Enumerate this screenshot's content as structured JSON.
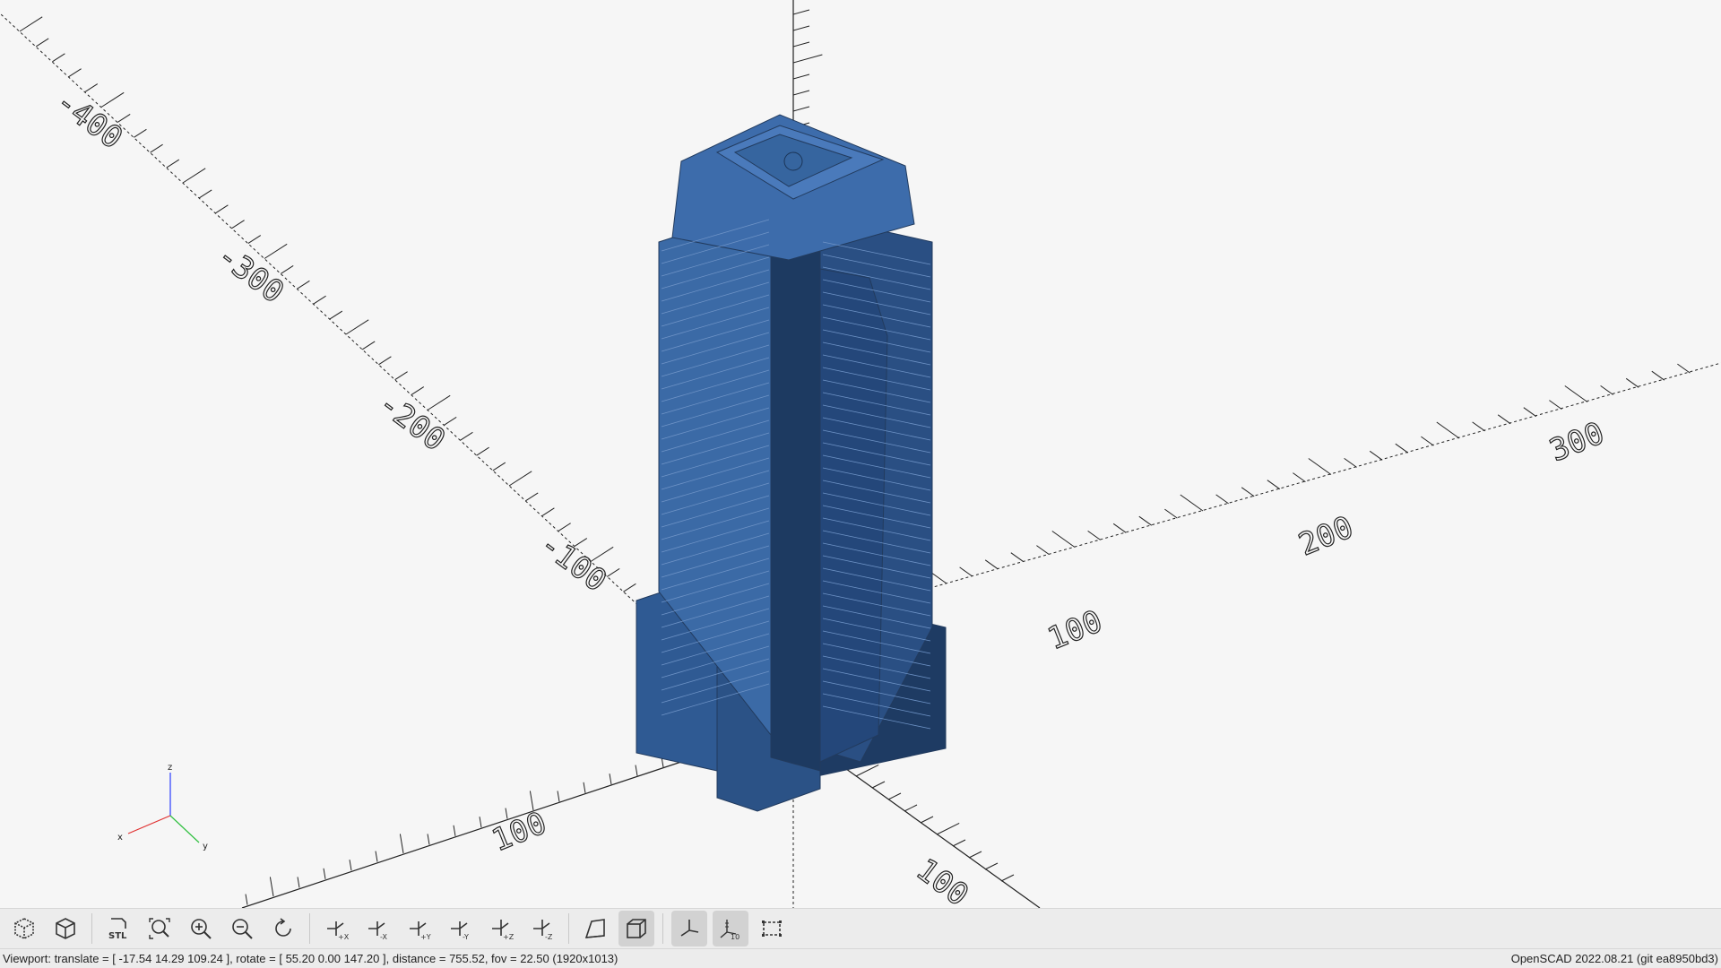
{
  "viewport": {
    "axis_labels": {
      "x_neg": [
        "-400",
        "-300",
        "-200",
        "-100"
      ],
      "y_pos": [
        "100",
        "200",
        "300"
      ],
      "near": [
        "100",
        "100"
      ]
    },
    "model_color": "#3b6aa6",
    "axis_indicator": {
      "x": "x",
      "y": "y",
      "z": "z"
    }
  },
  "toolbar": {
    "buttons": [
      {
        "icon": "render-preview-icon",
        "label": "Preview"
      },
      {
        "icon": "render-icon",
        "label": "Render"
      },
      {
        "icon": "export-stl-icon",
        "label": "Export as STL"
      },
      {
        "icon": "view-all-icon",
        "label": "View All"
      },
      {
        "icon": "zoom-in-icon",
        "label": "Zoom In"
      },
      {
        "icon": "zoom-out-icon",
        "label": "Zoom Out"
      },
      {
        "icon": "reset-view-icon",
        "label": "Reset View"
      },
      {
        "icon": "view-right-icon",
        "label": "+X"
      },
      {
        "icon": "view-left-icon",
        "label": "-X"
      },
      {
        "icon": "view-back-icon",
        "label": "+Y"
      },
      {
        "icon": "view-front-icon",
        "label": "-Y"
      },
      {
        "icon": "view-top-icon",
        "label": "+Z"
      },
      {
        "icon": "view-bottom-icon",
        "label": "-Z"
      },
      {
        "icon": "perspective-icon",
        "label": "Perspective"
      },
      {
        "icon": "orthogonal-icon",
        "label": "Orthogonal"
      },
      {
        "icon": "show-axes-icon",
        "label": "Show Axes"
      },
      {
        "icon": "show-scale-icon",
        "label": "Show Scale Markers"
      },
      {
        "icon": "show-edges-icon",
        "label": "Show Edges"
      }
    ]
  },
  "status": {
    "viewport_text": "Viewport: translate = [ -17.54 14.29 109.24 ], rotate = [ 55.20 0.00 147.20 ], distance = 755.52, fov = 22.50 (1920x1013)",
    "version_text": "OpenSCAD 2022.08.21 (git ea8950bd3)"
  }
}
